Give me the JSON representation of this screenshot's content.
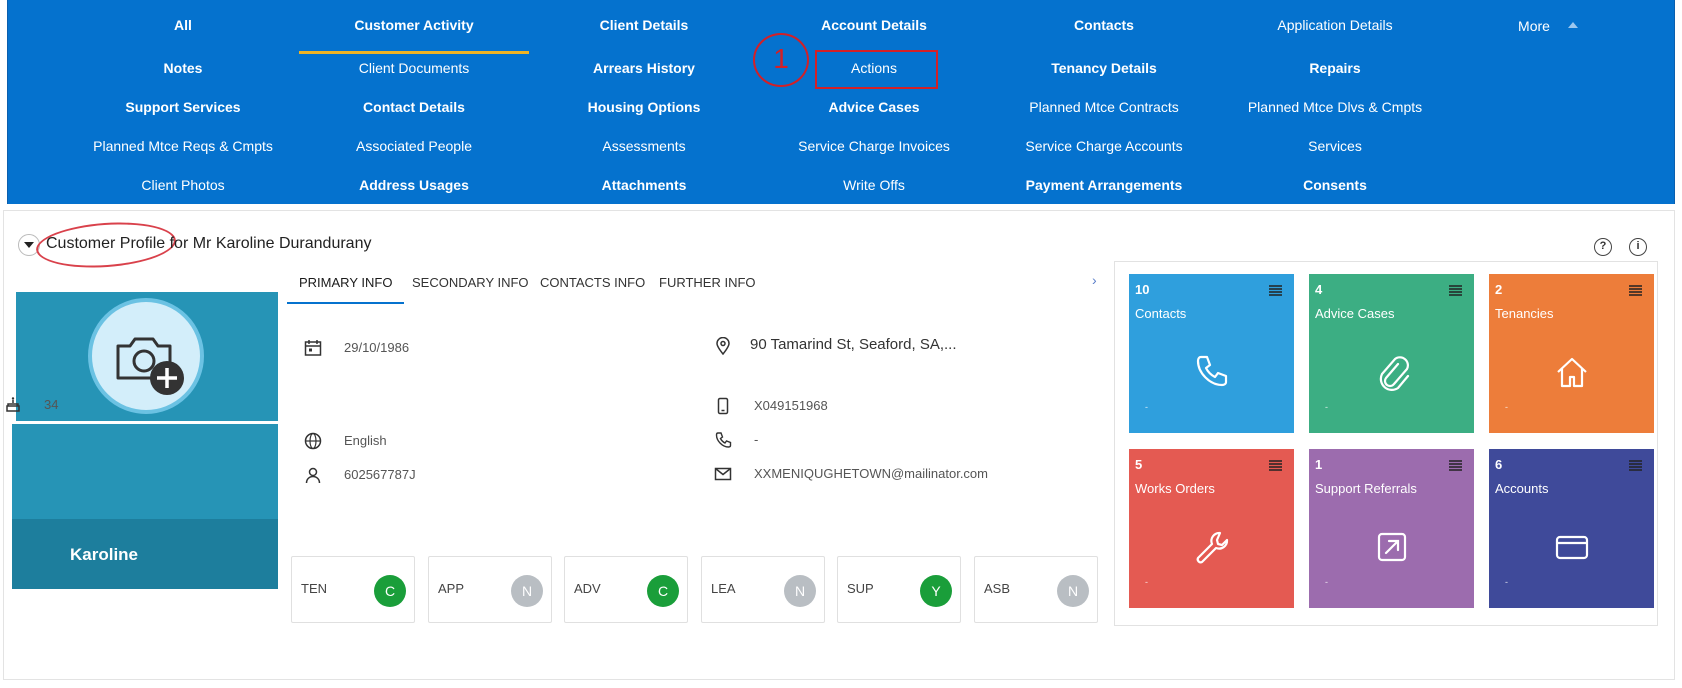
{
  "nav": {
    "row1": [
      "All",
      "Customer Activity",
      "Client Details",
      "Account Details",
      "Contacts",
      "Application Details",
      "More"
    ],
    "row2": [
      "Notes",
      "Client Documents",
      "Arrears History",
      "Actions",
      "Tenancy Details",
      "Repairs"
    ],
    "row3": [
      "Support Services",
      "Contact Details",
      "Housing Options",
      "Advice Cases",
      "Planned Mtce Contracts",
      "Planned Mtce Dlvs & Cmpts"
    ],
    "row4": [
      "Planned Mtce Reqs & Cmpts",
      "Associated People",
      "Assessments",
      "Service Charge Invoices",
      "Service Charge Accounts",
      "Services"
    ],
    "row5": [
      "Client Photos",
      "Address Usages",
      "Attachments",
      "Write Offs",
      "Payment Arrangements",
      "Consents"
    ],
    "active": "Customer Activity",
    "annotation_number": "1"
  },
  "profile": {
    "title": "Customer Profile for Mr Karoline Durandurany",
    "name": "Karoline",
    "help_icon": "question-icon",
    "info_icon": "info-icon"
  },
  "tabs": [
    "PRIMARY INFO",
    "SECONDARY INFO",
    "CONTACTS INFO",
    "FURTHER INFO"
  ],
  "tab_next": "›",
  "primary_info": {
    "dob": "29/10/1986",
    "age": "34",
    "language": "English",
    "id_number": "602567787J",
    "address": "90 Tamarind St, Seaford, SA,...",
    "mobile": "X049151968",
    "phone": "-",
    "email": "XXMENIQUGHETOWN@mailinator.com"
  },
  "flags": [
    {
      "code": "TEN",
      "value": "C",
      "color": "#1a9e3a"
    },
    {
      "code": "APP",
      "value": "N",
      "color": "#b9bec3"
    },
    {
      "code": "ADV",
      "value": "C",
      "color": "#1a9e3a"
    },
    {
      "code": "LEA",
      "value": "N",
      "color": "#b9bec3"
    },
    {
      "code": "SUP",
      "value": "Y",
      "color": "#1a9e3a"
    },
    {
      "code": "ASB",
      "value": "N",
      "color": "#b9bec3"
    }
  ],
  "tiles": [
    {
      "count": "10",
      "label": "Contacts",
      "color": "#2f9fdd",
      "icon": "phone-icon",
      "dash": "-"
    },
    {
      "count": "4",
      "label": "Advice Cases",
      "color": "#3cae83",
      "icon": "paperclip-icon",
      "dash": "-"
    },
    {
      "count": "2",
      "label": "Tenancies",
      "color": "#ed7d3a",
      "icon": "home-icon",
      "dash": "-"
    },
    {
      "count": "5",
      "label": "Works Orders",
      "color": "#e45a52",
      "icon": "wrench-icon",
      "dash": "-"
    },
    {
      "count": "1",
      "label": "Support Referrals",
      "color": "#9c6cae",
      "icon": "external-link-icon",
      "dash": "-"
    },
    {
      "count": "6",
      "label": "Accounts",
      "color": "#3f4a9a",
      "icon": "credit-card-icon",
      "dash": "-"
    }
  ]
}
